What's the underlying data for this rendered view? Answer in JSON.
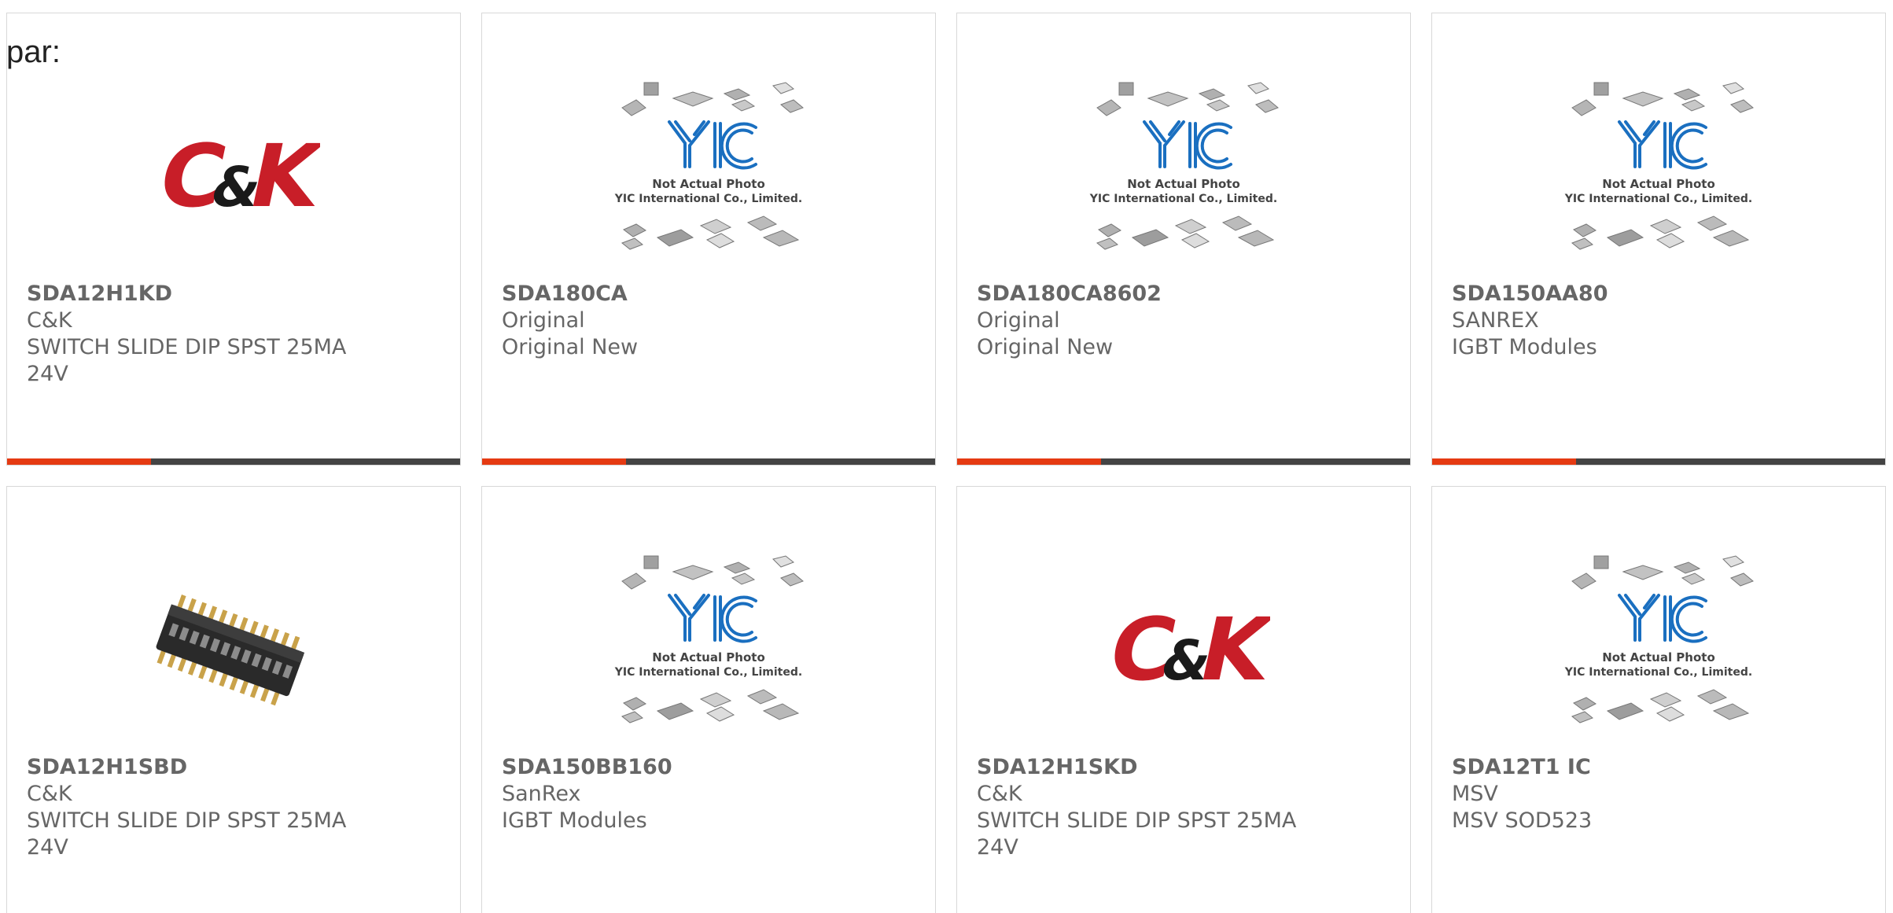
{
  "prefix_label": "par:",
  "placeholder_image": {
    "line1": "Not Actual Photo",
    "line2": "YIC International Co., Limited."
  },
  "colors": {
    "accent": "#e53a12",
    "bar": "#444444",
    "text": "#666666",
    "ck_red": "#c81e28",
    "yic_blue": "#1a6fc0"
  },
  "products": [
    {
      "part": "SDA12H1KD",
      "brand": "C&K",
      "desc": "SWITCH SLIDE DIP SPST 25MA 24V",
      "image": "ck-logo"
    },
    {
      "part": "SDA180CA",
      "brand": "Original",
      "desc": "Original New",
      "image": "yic-placeholder"
    },
    {
      "part": "SDA180CA8602",
      "brand": "Original",
      "desc": "Original New",
      "image": "yic-placeholder"
    },
    {
      "part": "SDA150AA80",
      "brand": "SANREX",
      "desc": "IGBT Modules",
      "image": "yic-placeholder"
    },
    {
      "part": "SDA12H1SBD",
      "brand": "C&K",
      "desc": "SWITCH SLIDE DIP SPST 25MA 24V",
      "image": "dip-switch-photo"
    },
    {
      "part": "SDA150BB160",
      "brand": "SanRex",
      "desc": "IGBT Modules",
      "image": "yic-placeholder"
    },
    {
      "part": "SDA12H1SKD",
      "brand": "C&K",
      "desc": "SWITCH SLIDE DIP SPST 25MA 24V",
      "image": "ck-logo"
    },
    {
      "part": "SDA12T1 IC",
      "brand": "MSV",
      "desc": "MSV SOD523",
      "image": "yic-placeholder"
    }
  ]
}
